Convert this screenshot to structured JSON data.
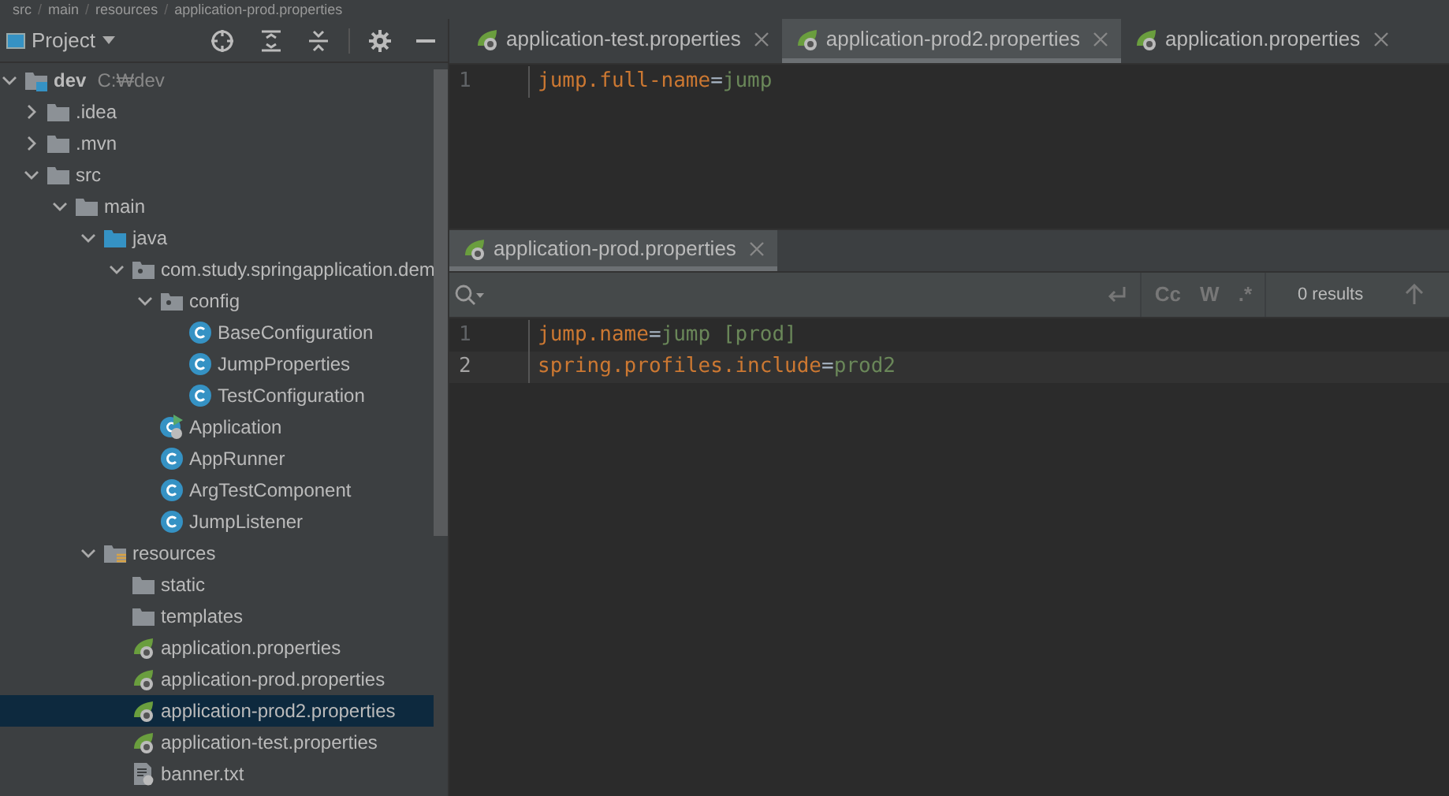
{
  "breadcrumb": {
    "separator": "/",
    "items": [
      "src",
      "main",
      "resources",
      "application-prod.properties"
    ]
  },
  "project_panel": {
    "title": "Project",
    "tree": [
      {
        "kind": "module",
        "label": "dev",
        "path": "C:₩dev",
        "expanded": true,
        "selected": false,
        "children": [
          {
            "kind": "folder",
            "label": ".idea",
            "expanded": false,
            "selected": false
          },
          {
            "kind": "folder",
            "label": ".mvn",
            "expanded": false,
            "selected": false
          },
          {
            "kind": "folder",
            "label": "src",
            "expanded": true,
            "selected": false,
            "children": [
              {
                "kind": "folder",
                "label": "main",
                "expanded": true,
                "selected": false,
                "children": [
                  {
                    "kind": "source",
                    "label": "java",
                    "expanded": true,
                    "selected": false,
                    "children": [
                      {
                        "kind": "package",
                        "label": "com.study.springapplication.dem",
                        "expanded": true,
                        "selected": false,
                        "children": [
                          {
                            "kind": "package",
                            "label": "config",
                            "expanded": true,
                            "selected": false,
                            "children": [
                              {
                                "kind": "class",
                                "label": "BaseConfiguration",
                                "selected": false
                              },
                              {
                                "kind": "class",
                                "label": "JumpProperties",
                                "selected": false
                              },
                              {
                                "kind": "class",
                                "label": "TestConfiguration",
                                "selected": false
                              }
                            ]
                          },
                          {
                            "kind": "boot",
                            "label": "Application",
                            "selected": false
                          },
                          {
                            "kind": "class",
                            "label": "AppRunner",
                            "selected": false
                          },
                          {
                            "kind": "class",
                            "label": "ArgTestComponent",
                            "selected": false
                          },
                          {
                            "kind": "class",
                            "label": "JumpListener",
                            "selected": false
                          }
                        ]
                      }
                    ]
                  },
                  {
                    "kind": "resources",
                    "label": "resources",
                    "expanded": true,
                    "selected": false,
                    "children": [
                      {
                        "kind": "folder",
                        "label": "static",
                        "selected": false
                      },
                      {
                        "kind": "folder",
                        "label": "templates",
                        "selected": false
                      },
                      {
                        "kind": "properties",
                        "label": "application.properties",
                        "selected": false
                      },
                      {
                        "kind": "properties",
                        "label": "application-prod.properties",
                        "selected": false
                      },
                      {
                        "kind": "properties",
                        "label": "application-prod2.properties",
                        "selected": true
                      },
                      {
                        "kind": "properties",
                        "label": "application-test.properties",
                        "selected": false
                      },
                      {
                        "kind": "text",
                        "label": "banner.txt",
                        "selected": false
                      }
                    ]
                  }
                ]
              }
            ]
          }
        ]
      }
    ]
  },
  "top_editor": {
    "tabs": [
      {
        "label": "application-test.properties",
        "selected": false
      },
      {
        "label": "application-prod2.properties",
        "selected": true
      },
      {
        "label": "application.properties",
        "selected": false
      }
    ],
    "lines": [
      {
        "number": "1",
        "current": false,
        "tokens": [
          {
            "kind": "key",
            "text": "jump.full-name"
          },
          {
            "kind": "sep",
            "text": "="
          },
          {
            "kind": "value",
            "text": "jump"
          }
        ]
      }
    ]
  },
  "bottom_editor": {
    "tabs": [
      {
        "label": "application-prod.properties",
        "selected": true
      }
    ],
    "search": {
      "cc": "Cc",
      "w": "W",
      "regex": ".*",
      "results": "0 results"
    },
    "lines": [
      {
        "number": "1",
        "current": false,
        "tokens": [
          {
            "kind": "key",
            "text": "jump.name"
          },
          {
            "kind": "sep",
            "text": "="
          },
          {
            "kind": "value",
            "text": "jump [prod]"
          }
        ]
      },
      {
        "number": "2",
        "current": true,
        "tokens": [
          {
            "kind": "key",
            "text": "spring.profiles.include"
          },
          {
            "kind": "sep",
            "text": "="
          },
          {
            "kind": "value",
            "text": "prod2"
          }
        ]
      }
    ]
  }
}
